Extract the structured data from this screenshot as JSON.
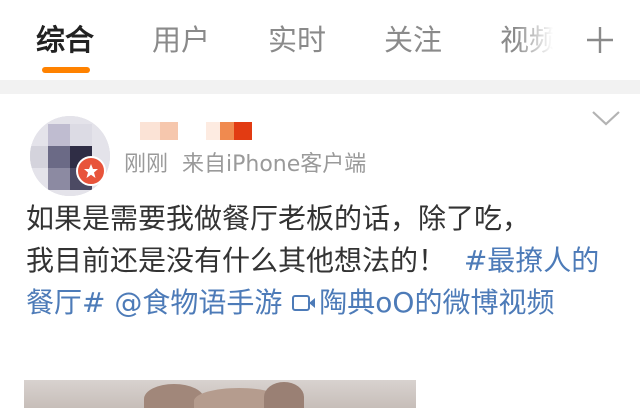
{
  "tabs": [
    {
      "label": "综合",
      "active": true
    },
    {
      "label": "用户",
      "active": false
    },
    {
      "label": "实时",
      "active": false
    },
    {
      "label": "关注",
      "active": false
    },
    {
      "label": "视频",
      "active": false
    }
  ],
  "colors": {
    "accent": "#ff8200",
    "link": "#4d7bb8",
    "verified_badge": "#e8543b"
  },
  "post": {
    "time": "刚刚",
    "source": "来自iPhone客户端",
    "text_line1": "如果是需要我做餐厅老板的话，除了吃，",
    "text_line2": "我目前还是没有什么其他想法的！",
    "hashtag": "#最撩人的餐厅#",
    "mention": "@食物语手游",
    "video_link": "陶典oO的微博视频"
  },
  "icons": {
    "add_tab": "plus-icon",
    "more": "chevron-down-icon",
    "verified": "verified-badge-icon",
    "video": "video-link-icon"
  }
}
